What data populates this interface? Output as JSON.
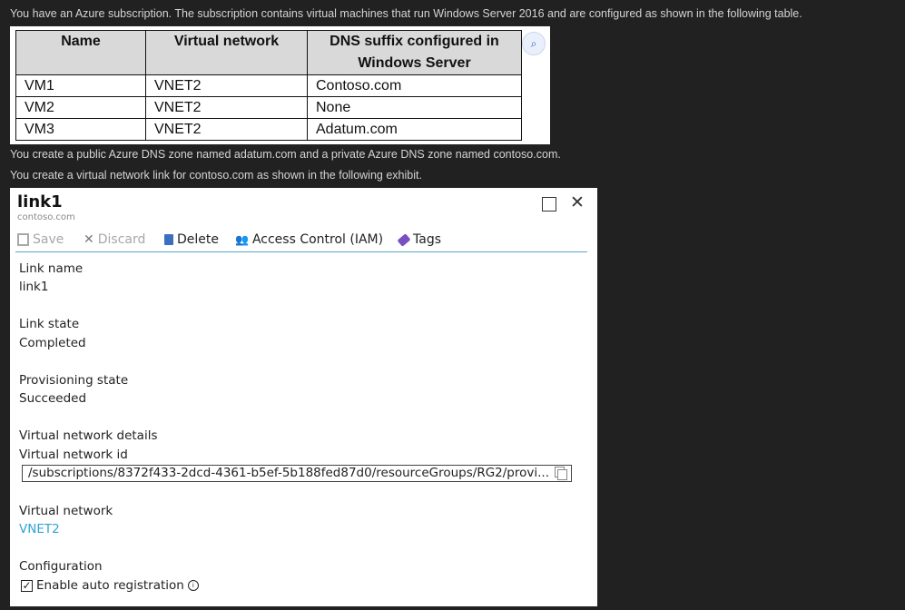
{
  "intro": {
    "p1": "You have an Azure subscription. The subscription contains virtual machines that run Windows Server 2016 and are configured as shown in the following table.",
    "p2": "You create a public Azure DNS zone named adatum.com and a private Azure DNS zone named contoso.com.",
    "p3": "You create a virtual network link for contoso.com as shown in the following exhibit."
  },
  "vm_table": {
    "headers": [
      "Name",
      "Virtual network",
      "DNS suffix configured in",
      "Windows Server"
    ],
    "rows": [
      [
        "VM1",
        "VNET2",
        "Contoso.com"
      ],
      [
        "VM2",
        "VNET2",
        "None"
      ],
      [
        "VM3",
        "VNET2",
        "Adatum.com"
      ]
    ],
    "lens_icon": "visual-search-icon"
  },
  "panel": {
    "title": "link1",
    "subtitle": "contoso.com",
    "toolbar": {
      "save": "Save",
      "discard": "Discard",
      "delete": "Delete",
      "iam": "Access Control (IAM)",
      "tags": "Tags"
    },
    "fields": {
      "link_name_label": "Link name",
      "link_name_value": "link1",
      "link_state_label": "Link state",
      "link_state_value": "Completed",
      "prov_state_label": "Provisioning state",
      "prov_state_value": "Succeeded",
      "vnet_details_label": "Virtual network details",
      "vnet_id_label": "Virtual network id",
      "vnet_id_value": "/subscriptions/8372f433-2dcd-4361-b5ef-5b188fed87d0/resourceGroups/RG2/provi...",
      "vnet_label": "Virtual network",
      "vnet_value": "VNET2",
      "config_label": "Configuration",
      "auto_reg_label": "Enable auto registration"
    },
    "accent": "#2da3d8"
  }
}
